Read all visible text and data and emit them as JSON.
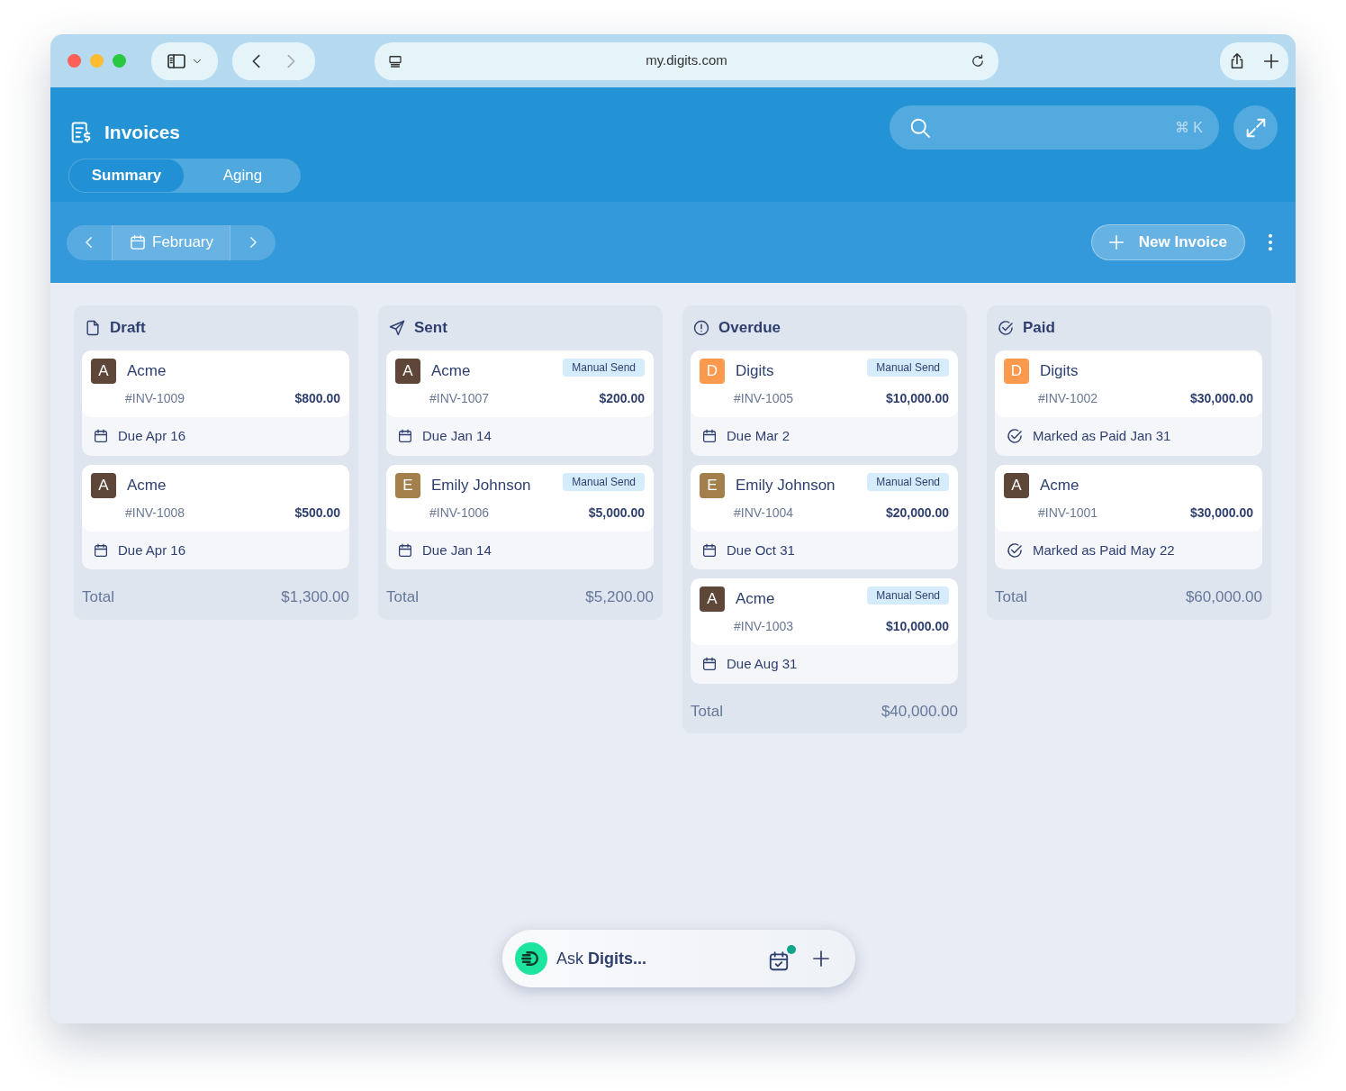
{
  "browser": {
    "url": "my.digits.com"
  },
  "header": {
    "title": "Invoices",
    "search": {
      "shortcut": "⌘ K"
    },
    "tabs": [
      {
        "label": "Summary",
        "selected": true
      },
      {
        "label": "Aging",
        "selected": false
      }
    ]
  },
  "toolbar": {
    "month": "February",
    "new_button": "New Invoice"
  },
  "columns": [
    {
      "kind": "draft",
      "title": "Draft",
      "total_label": "Total",
      "total": "$1,300.00",
      "invoices": [
        {
          "avatar": "A",
          "color": "#5e4638",
          "customer": "Acme",
          "number": "#INV-1009",
          "amount": "$800.00",
          "footer": {
            "kind": "due",
            "text": "Due Apr 16"
          }
        },
        {
          "avatar": "A",
          "color": "#5e4638",
          "customer": "Acme",
          "number": "#INV-1008",
          "amount": "$500.00",
          "footer": {
            "kind": "due",
            "text": "Due Apr 16"
          }
        }
      ]
    },
    {
      "kind": "sent",
      "title": "Sent",
      "total_label": "Total",
      "total": "$5,200.00",
      "invoices": [
        {
          "avatar": "A",
          "color": "#5e4638",
          "customer": "Acme",
          "tag": "Manual Send",
          "number": "#INV-1007",
          "amount": "$200.00",
          "footer": {
            "kind": "due",
            "text": "Due Jan 14"
          }
        },
        {
          "avatar": "E",
          "color": "#a27f4b",
          "customer": "Emily Johnson",
          "tag": "Manual Send",
          "number": "#INV-1006",
          "amount": "$5,000.00",
          "footer": {
            "kind": "due",
            "text": "Due Jan 14"
          }
        }
      ]
    },
    {
      "kind": "overdue",
      "title": "Overdue",
      "total_label": "Total",
      "total": "$40,000.00",
      "invoices": [
        {
          "avatar": "D",
          "color": "#fb9a4e",
          "customer": "Digits",
          "tag": "Manual Send",
          "number": "#INV-1005",
          "amount": "$10,000.00",
          "footer": {
            "kind": "due",
            "text": "Due Mar 2"
          }
        },
        {
          "avatar": "E",
          "color": "#a27f4b",
          "customer": "Emily Johnson",
          "tag": "Manual Send",
          "number": "#INV-1004",
          "amount": "$20,000.00",
          "footer": {
            "kind": "due",
            "text": "Due Oct 31"
          }
        },
        {
          "avatar": "A",
          "color": "#5e4638",
          "customer": "Acme",
          "tag": "Manual Send",
          "number": "#INV-1003",
          "amount": "$10,000.00",
          "footer": {
            "kind": "due",
            "text": "Due Aug 31"
          }
        }
      ]
    },
    {
      "kind": "paid",
      "title": "Paid",
      "total_label": "Total",
      "total": "$60,000.00",
      "invoices": [
        {
          "avatar": "D",
          "color": "#fb9a4e",
          "customer": "Digits",
          "number": "#INV-1002",
          "amount": "$30,000.00",
          "footer": {
            "kind": "paid",
            "text": "Marked as Paid Jan 31"
          }
        },
        {
          "avatar": "A",
          "color": "#5e4638",
          "customer": "Acme",
          "number": "#INV-1001",
          "amount": "$30,000.00",
          "footer": {
            "kind": "paid",
            "text": "Marked as Paid May 22"
          }
        }
      ]
    }
  ],
  "assistant": {
    "prompt": "Ask **Digits...**",
    "notification": true
  }
}
